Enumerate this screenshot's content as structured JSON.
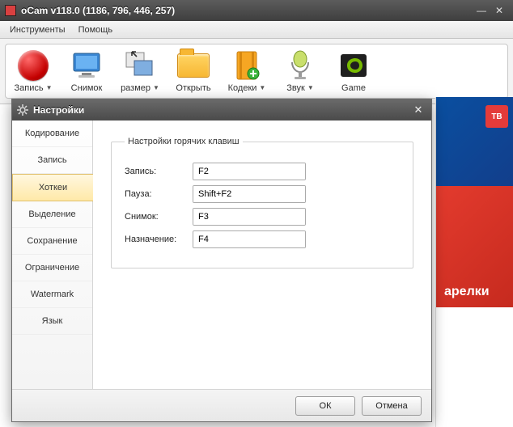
{
  "window": {
    "title": "oCam v118.0 (1186, 796, 446, 257)"
  },
  "menu": {
    "tools": "Инструменты",
    "help": "Помощь"
  },
  "toolbar": {
    "record": "Запись",
    "capture": "Снимок",
    "resize": "размер",
    "open": "Открыть",
    "codecs": "Кодеки",
    "sound": "Звук",
    "game": "Game"
  },
  "dialog": {
    "title": "Настройки",
    "tabs": {
      "encoding": "Кодирование",
      "record": "Запись",
      "hotkeys": "Хоткеи",
      "selection": "Выделение",
      "save": "Сохранение",
      "limit": "Ограничение",
      "watermark": "Watermark",
      "lang": "Язык"
    },
    "group_title": "Настройки горячих клавиш",
    "labels": {
      "record": "Запись:",
      "pause": "Пауза:",
      "capture": "Снимок:",
      "assign": "Назначение:"
    },
    "values": {
      "record": "F2",
      "pause": "Shift+F2",
      "capture": "F3",
      "assign": "F4"
    },
    "buttons": {
      "ok": "ОК",
      "cancel": "Отмена"
    }
  },
  "ad": {
    "tv": "ТВ",
    "text": "арелки"
  }
}
